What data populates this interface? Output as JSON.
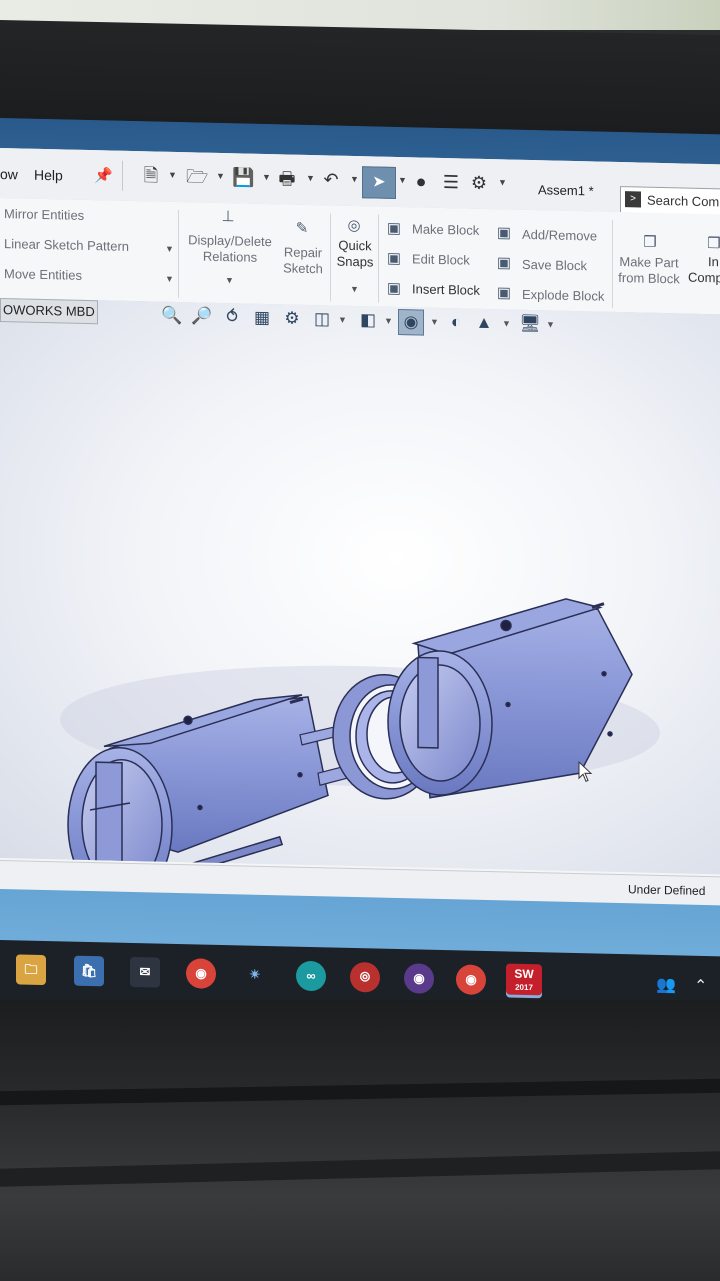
{
  "menubar": {
    "items": [
      "ow",
      "Help"
    ],
    "document_title": "Assem1 *",
    "search_label": "Search Comm"
  },
  "ribbon": {
    "sketch_tools": [
      "Mirror Entities",
      "Linear Sketch Pattern",
      "Move Entities"
    ],
    "display_delete_relations": [
      "Display/Delete",
      "Relations"
    ],
    "repair_sketch": [
      "Repair",
      "Sketch"
    ],
    "quick_snaps": [
      "Quick",
      "Snaps"
    ],
    "blocks_col1": [
      "Make Block",
      "Edit Block",
      "Insert Block"
    ],
    "blocks_col2": [
      "Add/Remove",
      "Save Block",
      "Explode Block"
    ],
    "make_part_from_block": [
      "Make Part",
      "from Block"
    ],
    "insert_components": [
      "In",
      "Comp"
    ]
  },
  "tabs": {
    "mbd": "OWORKS MBD"
  },
  "status": {
    "sketch_state": "Under Defined"
  },
  "taskbar": {
    "solidworks_badge": "SW",
    "solidworks_year": "2017"
  },
  "colors": {
    "part_body": "#8c99d8",
    "part_edge": "#2a2f55",
    "select_active": "#6f8fae",
    "taskbar": "#1c2128"
  }
}
